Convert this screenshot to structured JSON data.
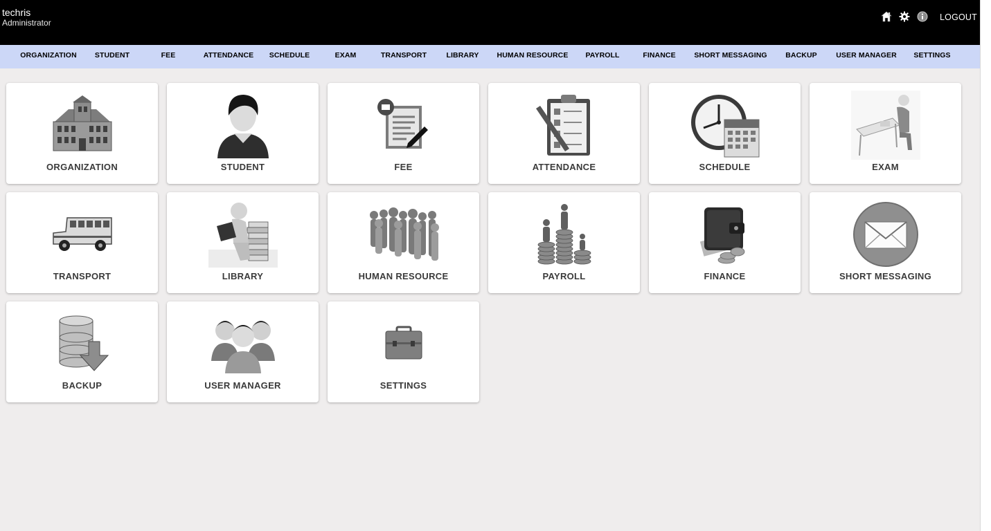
{
  "header": {
    "user_name": "techris",
    "user_role": "Administrator",
    "icons": [
      "home-icon",
      "gear-icon",
      "info-icon"
    ],
    "logout_label": "LOGOUT"
  },
  "nav": {
    "items": [
      {
        "label": "ORGANIZATION"
      },
      {
        "label": "STUDENT"
      },
      {
        "label": "FEE"
      },
      {
        "label": "ATTENDANCE"
      },
      {
        "label": "SCHEDULE"
      },
      {
        "label": "EXAM"
      },
      {
        "label": "TRANSPORT"
      },
      {
        "label": "LIBRARY"
      },
      {
        "label": "HUMAN RESOURCE"
      },
      {
        "label": "PAYROLL"
      },
      {
        "label": "FINANCE"
      },
      {
        "label": "SHORT MESSAGING"
      },
      {
        "label": "BACKUP"
      },
      {
        "label": "USER MANAGER"
      },
      {
        "label": "SETTINGS"
      }
    ]
  },
  "tiles": [
    {
      "label": "ORGANIZATION",
      "icon": "building-icon"
    },
    {
      "label": "STUDENT",
      "icon": "student-avatar-icon"
    },
    {
      "label": "FEE",
      "icon": "fee-invoice-icon"
    },
    {
      "label": "ATTENDANCE",
      "icon": "clipboard-icon"
    },
    {
      "label": "SCHEDULE",
      "icon": "clock-calendar-icon"
    },
    {
      "label": "EXAM",
      "icon": "exam-desk-icon"
    },
    {
      "label": "TRANSPORT",
      "icon": "school-bus-icon"
    },
    {
      "label": "LIBRARY",
      "icon": "reading-books-icon"
    },
    {
      "label": "HUMAN RESOURCE",
      "icon": "people-crowd-icon"
    },
    {
      "label": "PAYROLL",
      "icon": "coin-stacks-icon"
    },
    {
      "label": "FINANCE",
      "icon": "wallet-icon"
    },
    {
      "label": "SHORT MESSAGING",
      "icon": "envelope-icon"
    },
    {
      "label": "BACKUP",
      "icon": "database-download-icon"
    },
    {
      "label": "USER MANAGER",
      "icon": "user-group-icon"
    },
    {
      "label": "SETTINGS",
      "icon": "briefcase-icon"
    }
  ]
}
